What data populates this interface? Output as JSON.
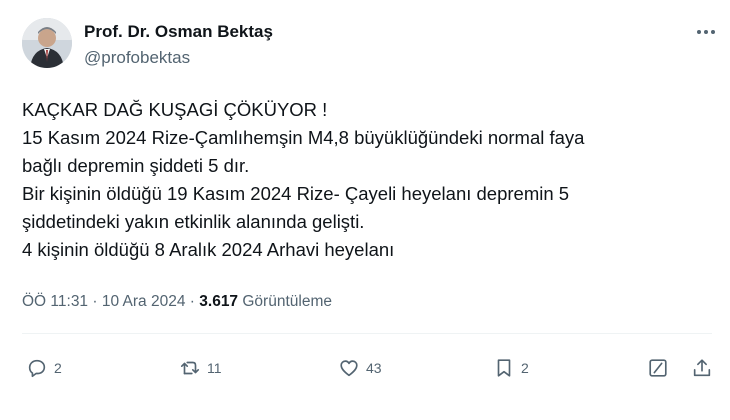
{
  "author": {
    "display_name": "Prof. Dr. Osman Bektaş",
    "handle": "@profobektas"
  },
  "tweet": {
    "lines": [
      "KAÇKAR DAĞ KUŞAGİ ÇÖKÜYOR !",
      "15 Kasım 2024 Rize-Çamlıhemşin M4,8 büyüklüğündeki normal faya",
      "bağlı depremin şiddeti 5 dır.",
      "Bir kişinin öldüğü 19 Kasım 2024 Rize- Çayeli heyelanı depremin 5",
      "şiddetindeki yakın etkinlik alanında gelişti.",
      "4 kişinin öldüğü 8 Aralık 2024 Arhavi heyelanı"
    ]
  },
  "meta": {
    "time": "ÖÖ 11:31",
    "separator": "·",
    "date": "10 Ara 2024",
    "views_count": "3.617",
    "views_label": "Görüntüleme"
  },
  "actions": {
    "reply_count": "2",
    "retweet_count": "11",
    "like_count": "43",
    "bookmark_count": "2"
  },
  "colors": {
    "text": "#0f1419",
    "secondary": "#536471",
    "divider": "#eff3f4"
  },
  "icons": [
    "more-icon",
    "reply-icon",
    "retweet-icon",
    "like-icon",
    "bookmark-icon",
    "grok-icon",
    "share-icon"
  ]
}
